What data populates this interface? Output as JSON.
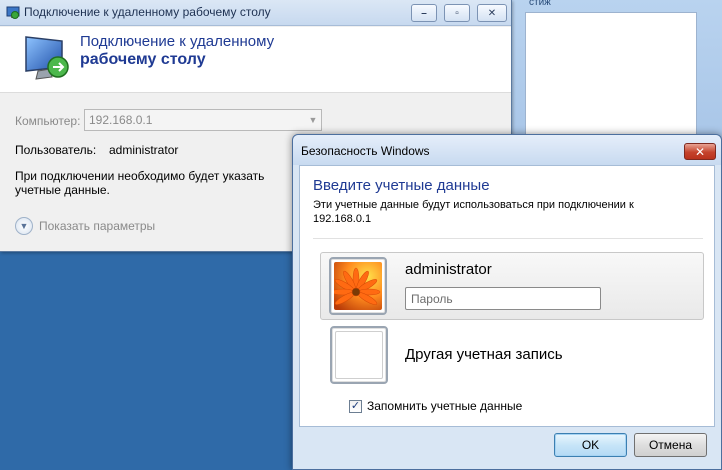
{
  "background_window": {
    "title_fragment": "стиж"
  },
  "rdp": {
    "title": "Подключение к удаленному рабочему столу",
    "header_line1": "Подключение к удаленному",
    "header_line2": "рабочему столу",
    "computer_label": "Компьютер:",
    "computer_value": "192.168.0.1",
    "user_label": "Пользователь:",
    "user_value": "administrator",
    "note": "При подключении необходимо будет указать учетные данные.",
    "options_label": "Показать параметры",
    "caption_buttons": {
      "minimize": "–",
      "maximize": "▫",
      "close": "✕"
    }
  },
  "security": {
    "title": "Безопасность Windows",
    "close": "✕",
    "heading": "Введите учетные данные",
    "description": "Эти учетные данные будут использоваться при подключении к 192.168.0.1",
    "selected_user": "administrator",
    "password_placeholder": "Пароль",
    "other_account": "Другая учетная запись",
    "remember_label": "Запомнить учетные данные",
    "remember_checked": true,
    "ok_label": "OK",
    "cancel_label": "Отмена"
  },
  "icons": {
    "rdp_logo": "monitor-arrow-icon",
    "avatar": "flower-avatar-icon",
    "options": "chevron-down-circle-icon"
  }
}
